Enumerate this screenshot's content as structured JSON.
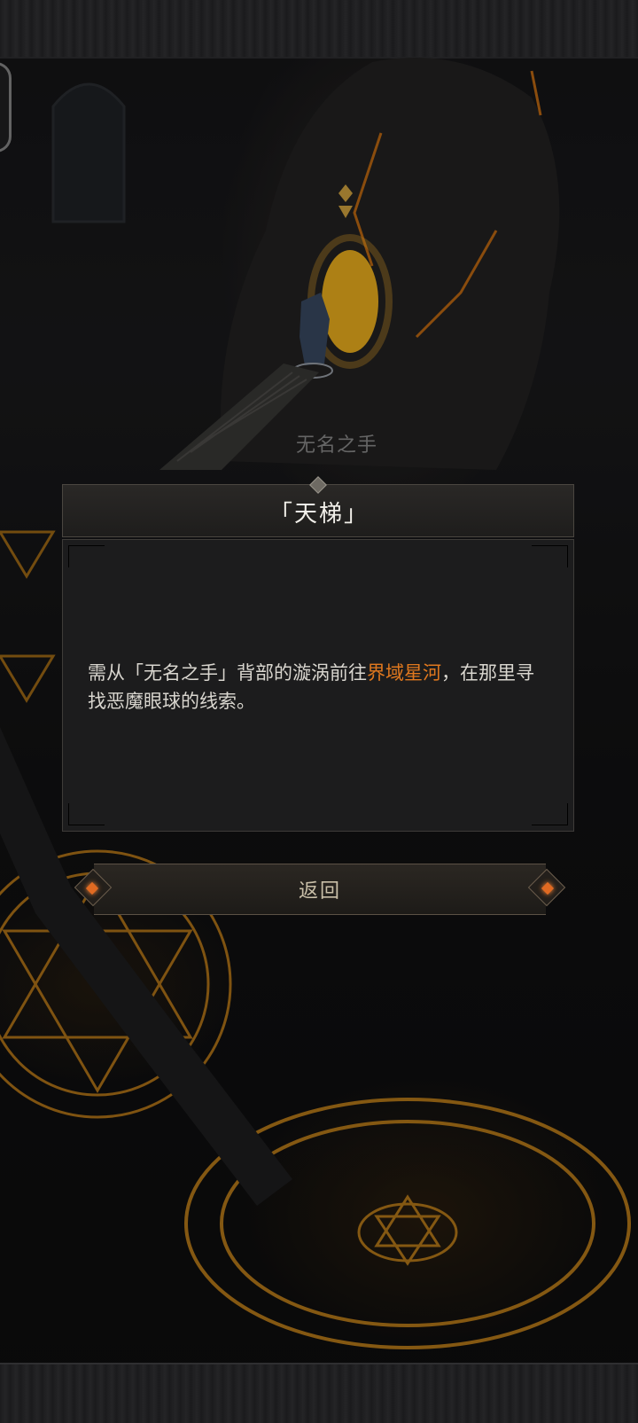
{
  "scene": {
    "npc_name": "无名之手"
  },
  "dialog": {
    "title": "「天梯」",
    "text_before": "需从「无名之手」背部的漩涡前往",
    "text_highlight": "界域星河",
    "text_after": "，在那里寻找恶魔眼球的线索。",
    "highlight_color": "#e0781e"
  },
  "actions": {
    "back_label": "返回"
  }
}
